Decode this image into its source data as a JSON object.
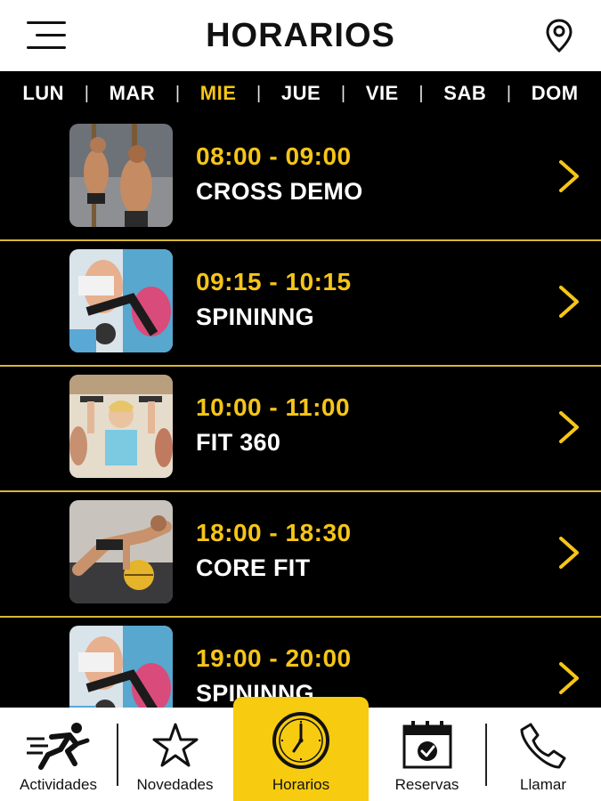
{
  "header": {
    "title": "HORARIOS",
    "menu_icon": "hamburger-menu-icon",
    "location_icon": "map-pin-icon"
  },
  "days": [
    {
      "label": "LUN",
      "active": false
    },
    {
      "label": "MAR",
      "active": false
    },
    {
      "label": "MIE",
      "active": true
    },
    {
      "label": "JUE",
      "active": false
    },
    {
      "label": "VIE",
      "active": false
    },
    {
      "label": "SAB",
      "active": false
    },
    {
      "label": "DOM",
      "active": false
    }
  ],
  "classes": [
    {
      "time": "08:00 - 09:00",
      "name": "CROSS DEMO",
      "image": "crossfit-rope-climb"
    },
    {
      "time": "09:15 - 10:15",
      "name": "SPININNG",
      "image": "spinning-bike"
    },
    {
      "time": "10:00 - 11:00",
      "name": "FIT 360",
      "image": "dumbbell-class"
    },
    {
      "time": "18:00 - 18:30",
      "name": "CORE FIT",
      "image": "core-ball-exercise"
    },
    {
      "time": "19:00 - 20:00",
      "name": "SPININNG",
      "image": "spinning-bike"
    }
  ],
  "nav": [
    {
      "label": "Actividades",
      "icon": "running-person-icon",
      "active": false
    },
    {
      "label": "Novedades",
      "icon": "star-icon",
      "active": false
    },
    {
      "label": "Horarios",
      "icon": "clock-icon",
      "active": true
    },
    {
      "label": "Reservas",
      "icon": "calendar-check-icon",
      "active": false
    },
    {
      "label": "Llamar",
      "icon": "phone-icon",
      "active": false
    }
  ],
  "colors": {
    "accent": "#f5c518",
    "background": "#000000",
    "divider": "#d9b732",
    "nav_active": "#f7cb10"
  }
}
